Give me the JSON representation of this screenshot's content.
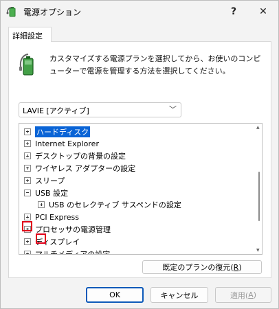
{
  "window": {
    "title": "電源オプション",
    "help_label": "?",
    "close_label": "✕"
  },
  "tabs": [
    {
      "label": "詳細設定"
    }
  ],
  "description": "カスタマイズする電源プランを選択してから、お使いのコンピューターで電源を管理する方法を選択してください。",
  "plan_select": {
    "value": "LAVIE [アクティブ]",
    "chevron": "﹀"
  },
  "tree": {
    "items": [
      {
        "label": "ハードディスク",
        "expander": "+",
        "indent": 0,
        "selected": true
      },
      {
        "label": "Internet Explorer",
        "expander": "+",
        "indent": 0
      },
      {
        "label": "デスクトップの背景の設定",
        "expander": "+",
        "indent": 0
      },
      {
        "label": "ワイヤレス アダプターの設定",
        "expander": "+",
        "indent": 0
      },
      {
        "label": "スリープ",
        "expander": "+",
        "indent": 0
      },
      {
        "label": "USB 設定",
        "expander": "−",
        "indent": 0,
        "highlighted": true
      },
      {
        "label": "USB のセレクティブ サスペンドの設定",
        "expander": "+",
        "indent": 1,
        "highlighted": true
      },
      {
        "label": "PCI Express",
        "expander": "+",
        "indent": 0
      },
      {
        "label": "プロセッサの電源管理",
        "expander": "+",
        "indent": 0
      },
      {
        "label": "ディスプレイ",
        "expander": "+",
        "indent": 0
      },
      {
        "label": "マルチメディアの設定",
        "expander": "+",
        "indent": 0
      }
    ]
  },
  "buttons": {
    "restore_prefix": "既定のプランの復元(",
    "restore_key": "R",
    "restore_suffix": ")",
    "ok": "OK",
    "cancel": "キャンセル",
    "apply_prefix": "適用(",
    "apply_key": "A",
    "apply_suffix": ")"
  },
  "colors": {
    "selection": "#0a64d6",
    "highlight_box": "#e0001a",
    "ok_border": "#0c59b9"
  }
}
